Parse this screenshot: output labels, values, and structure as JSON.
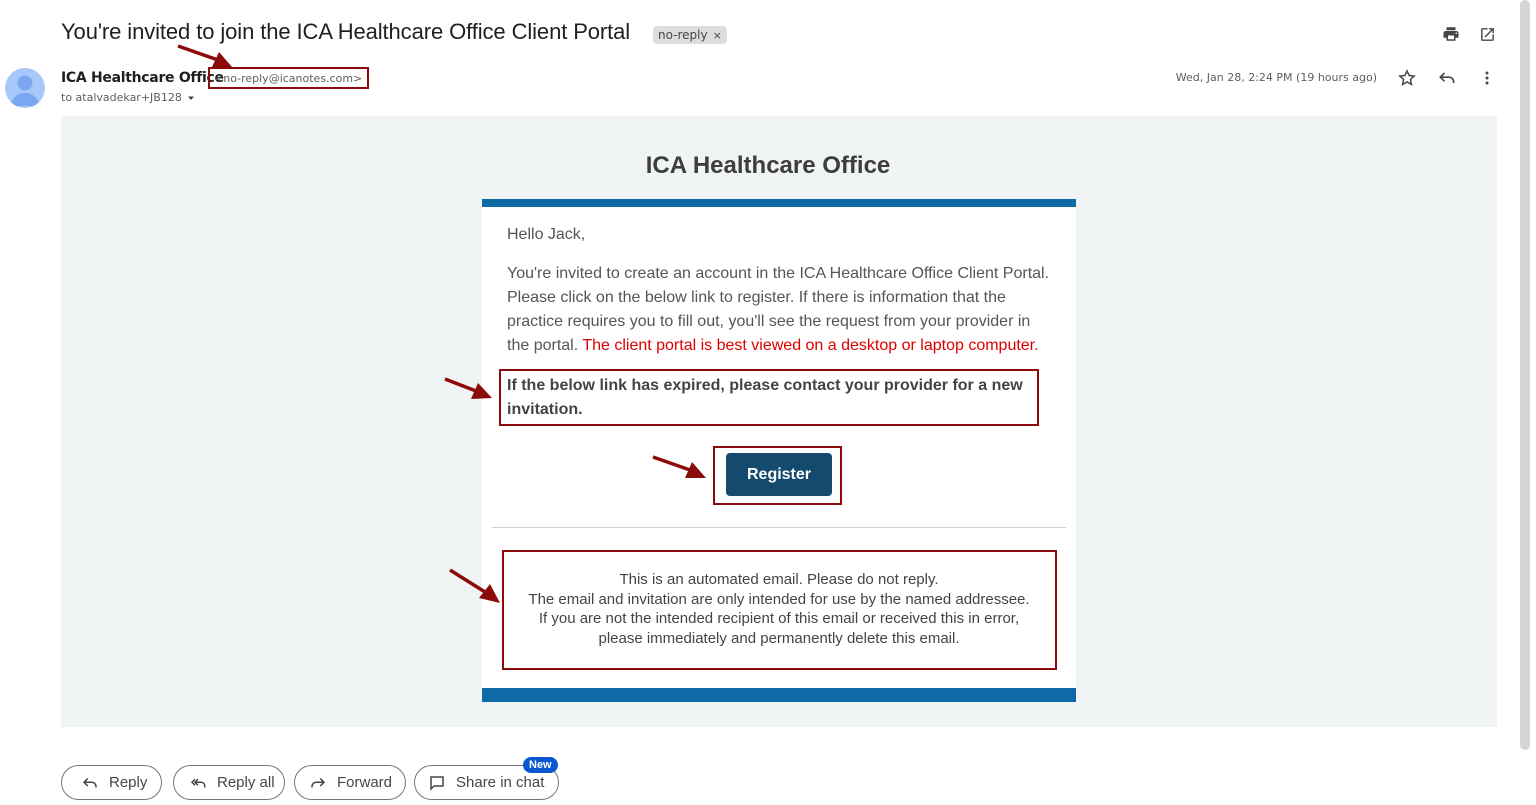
{
  "email": {
    "subject": "You're invited to join the ICA Healthcare Office Client Portal",
    "label_chip": "no-reply",
    "label_chip_close": "×",
    "sender_name": "ICA Healthcare Office",
    "sender_email": "<no-reply@icanotes.com>",
    "to_line": "to atalvadekar+JB128",
    "date": "Wed, Jan 28, 2:24 PM (19 hours ago)"
  },
  "body": {
    "org_title": "ICA Healthcare Office",
    "greeting": "Hello Jack,",
    "paragraph": "You're invited to create an account in the ICA Healthcare Office Client Portal. Please click on the below link to register. If there is information that the practice requires you to fill out, you'll see the request from your provider in the portal.",
    "paragraph_red": "The client portal is best viewed on a desktop or laptop computer.",
    "expired_note": "If the below link has expired, please contact your provider for a new invitation.",
    "register_label": "Register",
    "footer_line1": "This is an automated email. Please do not reply.",
    "footer_line2": "The email and invitation are only intended for use by the named addressee.",
    "footer_line3": "If you are not the intended recipient of this email or received this in error,",
    "footer_line4": "please immediately and permanently delete this email."
  },
  "actions": {
    "reply": "Reply",
    "reply_all": "Reply all",
    "forward": "Forward",
    "share_in_chat": "Share in chat",
    "new_badge": "New"
  },
  "colors": {
    "brand_blue": "#0e6aa6",
    "register_button": "#134a6d",
    "annotation_red": "#8b0a0a",
    "warning_red": "#e00000",
    "gmail_blue": "#0b57d0"
  },
  "icons": {
    "print": "print-icon",
    "open_new_window": "open-in-new-icon",
    "star": "star-icon",
    "reply": "reply-icon",
    "more": "more-vert-icon",
    "reply_all": "reply-all-icon",
    "forward": "forward-icon",
    "chat": "chat-icon",
    "avatar": "person-icon",
    "dropdown": "caret-down-icon"
  }
}
